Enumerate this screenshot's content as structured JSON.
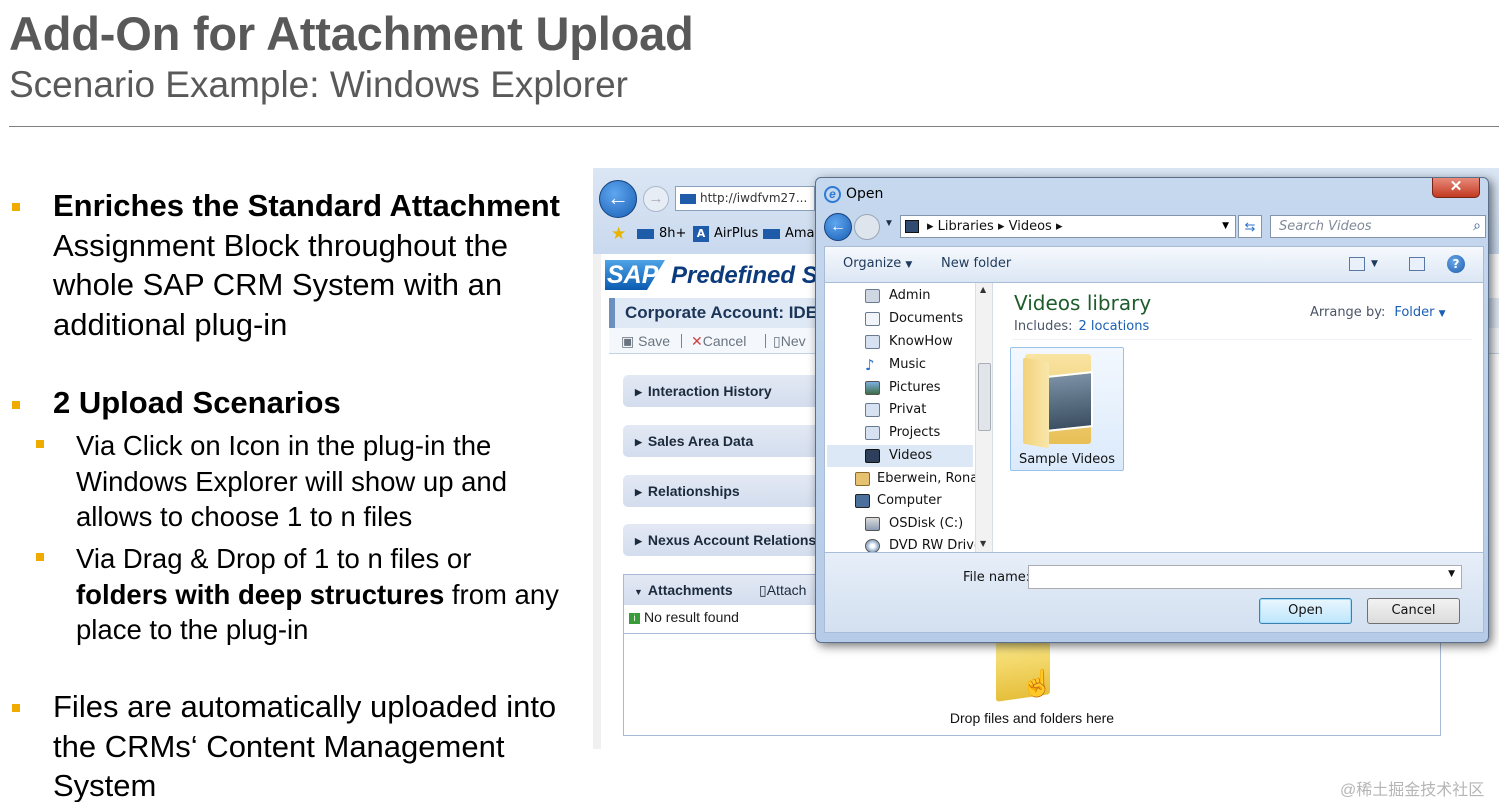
{
  "slide": {
    "title": "Add-On for Attachment Upload",
    "subtitle": "Scenario Example: Windows Explorer",
    "accent_color": "#f0ab00"
  },
  "bullets": {
    "b1_bold": "Enriches the Standard Attachment",
    "b1_rest": " Assignment Block throughout the whole SAP CRM System with an additional plug-in",
    "b2": "2 Upload Scenarios",
    "b2a": "Via Click on Icon in the plug-in the Windows Explorer will show up and allows to choose 1 to n files",
    "b2b_pre": "Via Drag & Drop of 1 to n files or ",
    "b2b_bold": "folders with deep structures",
    "b2b_post": " from any place to the plug-in",
    "b3": "Files are automatically uploaded into the CRMs‘ Content Management System"
  },
  "browser": {
    "url": "http://iwdfvm27...",
    "favorites": [
      "8h+",
      "AirPlus",
      "Ama"
    ]
  },
  "crm": {
    "logo": "SAP",
    "header_title": "Predefined S",
    "page_title": "Corporate Account: IDE",
    "toolbar": {
      "save": "Save",
      "cancel": "Cancel",
      "new": "Nev"
    },
    "blocks": [
      "Interaction History",
      "Sales Area Data",
      "Relationships",
      "Nexus Account Relations"
    ],
    "attachments": {
      "title": "Attachments",
      "action": "Attach",
      "no_result": "No result found",
      "drop_label": "Drop files and folders here"
    }
  },
  "dialog": {
    "title": "Open",
    "close": "✕",
    "path": [
      "Libraries",
      "Videos"
    ],
    "search_placeholder": "Search Videos",
    "organize": "Organize",
    "new_folder": "New folder",
    "nav_items": [
      {
        "label": "Admin",
        "icon": "user-folder-icon"
      },
      {
        "label": "Documents",
        "icon": "documents-icon"
      },
      {
        "label": "KnowHow",
        "icon": "library-icon"
      },
      {
        "label": "Music",
        "icon": "music-icon"
      },
      {
        "label": "Pictures",
        "icon": "pictures-icon"
      },
      {
        "label": "Privat",
        "icon": "library-icon"
      },
      {
        "label": "Projects",
        "icon": "library-icon"
      },
      {
        "label": "Videos",
        "icon": "videos-icon",
        "selected": true
      },
      {
        "label": "Eberwein, Ronald",
        "icon": "user-icon"
      },
      {
        "label": "Computer",
        "icon": "computer-icon"
      },
      {
        "label": "OSDisk (C:)",
        "icon": "disk-icon"
      },
      {
        "label": "DVD RW Drive (",
        "icon": "dvd-icon"
      }
    ],
    "library_title": "Videos library",
    "includes_label": "Includes:",
    "includes_link": "2 locations",
    "arrange_label": "Arrange by:",
    "arrange_value": "Folder",
    "items": [
      "Sample Videos"
    ],
    "file_name_label": "File name:",
    "file_name_value": "",
    "open_button": "Open",
    "cancel_button": "Cancel"
  },
  "watermark": "@稀土掘金技术社区"
}
